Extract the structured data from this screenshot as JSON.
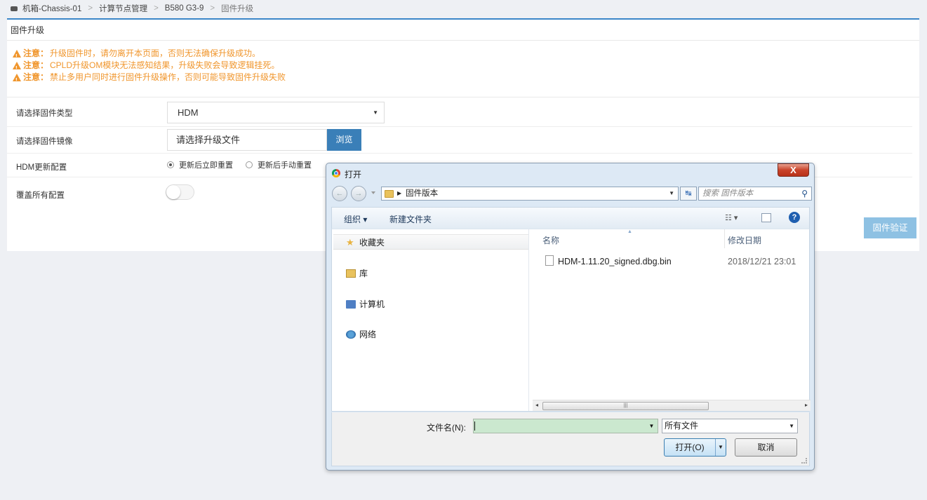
{
  "breadcrumb": {
    "items": [
      "机箱-Chassis-01",
      "计算节点管理",
      "B580 G3-9",
      "固件升级"
    ],
    "separator": ">"
  },
  "panel": {
    "title": "固件升级",
    "warning_prefix": "注意：",
    "warnings": [
      "升级固件时，请勿离开本页面，否则无法确保升级成功。",
      "CPLD升级OM模块无法感知结果，升级失败会导致逻辑挂死。",
      "禁止多用户同时进行固件升级操作，否则可能导致固件升级失败"
    ],
    "form": {
      "firmware_type_label": "请选择固件类型",
      "firmware_type_value": "HDM",
      "firmware_image_label": "请选择固件镜像",
      "firmware_image_placeholder": "请选择升级文件",
      "browse_label": "浏览",
      "hdm_config_label": "HDM更新配置",
      "hdm_options": [
        "更新后立即重置",
        "更新后手动重置"
      ],
      "hdm_selected": 0,
      "overwrite_label": "覆盖所有配置",
      "overwrite_on": false
    },
    "verify_label": "固件验证"
  },
  "dialog": {
    "title": "打开",
    "close_label": "X",
    "address_path": "固件版本",
    "search_placeholder": "搜索 固件版本",
    "toolbar": {
      "organize": "组织 ▾",
      "new_folder": "新建文件夹"
    },
    "nav_items": [
      "收藏夹",
      "库",
      "计算机",
      "网络"
    ],
    "columns": {
      "name": "名称",
      "date": "修改日期"
    },
    "files": [
      {
        "name": "HDM-1.11.20_signed.dbg.bin",
        "date": "2018/12/21 23:01"
      }
    ],
    "filename_label": "文件名(N):",
    "filename_value": "",
    "file_type": "所有文件",
    "open_label": "打开(O)",
    "cancel_label": "取消"
  },
  "colors": {
    "accent": "#3b86c8",
    "warning": "#f0962d",
    "browse": "#3a7fb8",
    "verify": "#8ec1e3"
  }
}
